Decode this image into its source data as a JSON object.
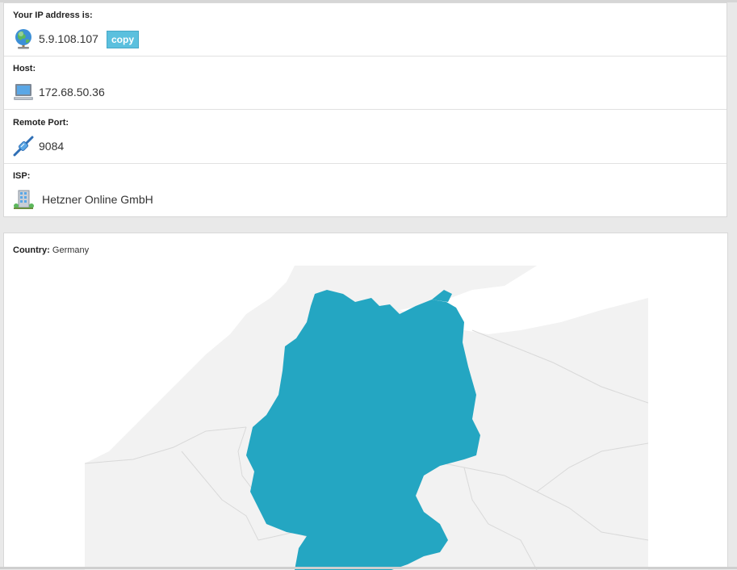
{
  "ip": {
    "label": "Your IP address is:",
    "value": "5.9.108.107",
    "copy_label": "copy",
    "icon": "globe-icon"
  },
  "host": {
    "label": "Host:",
    "value": "172.68.50.36",
    "icon": "computer-icon"
  },
  "port": {
    "label": "Remote Port:",
    "value": "9084",
    "icon": "network-cable-icon"
  },
  "isp": {
    "label": "ISP:",
    "value": "Hetzner Online GmbH",
    "icon": "building-icon"
  },
  "country": {
    "label": "Country:",
    "value": "Germany"
  },
  "map": {
    "highlight_color": "#24a6c2",
    "land_color": "#f2f2f2",
    "border_color": "#d9d9d9"
  }
}
